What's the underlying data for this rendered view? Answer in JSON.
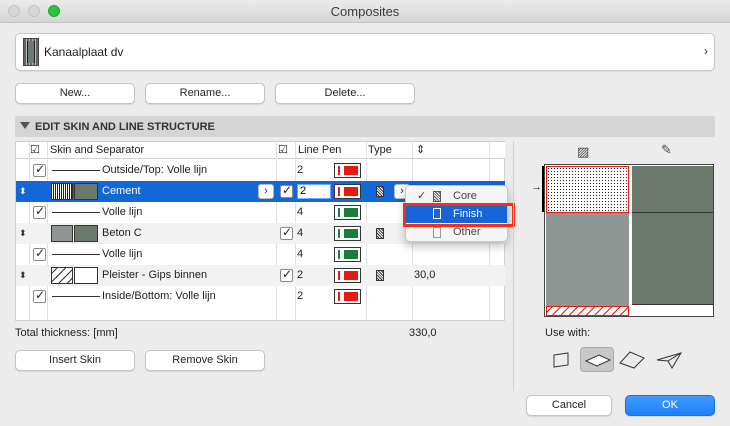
{
  "window": {
    "title": "Composites"
  },
  "composite": {
    "name": "Kanaalplaat dv"
  },
  "buttons": {
    "new": "New...",
    "rename": "Rename...",
    "delete": "Delete...",
    "insert_skin": "Insert Skin",
    "remove_skin": "Remove Skin",
    "cancel": "Cancel",
    "ok": "OK"
  },
  "section": {
    "title": "EDIT SKIN AND LINE STRUCTURE"
  },
  "table": {
    "headers": {
      "skin_sep": "Skin and Separator",
      "line_pen": "Line Pen",
      "type": "Type"
    },
    "rows": [
      {
        "kind": "line",
        "label": "Outside/Top: Volle lijn",
        "pen": "2",
        "pen_color": "#e8190f",
        "checked": true
      },
      {
        "kind": "skin",
        "label": "Cement",
        "pen": "2",
        "pen_color": "#e8190f",
        "checked": true,
        "selected": true,
        "thickness": ""
      },
      {
        "kind": "line",
        "label": "Volle lijn",
        "pen": "4",
        "pen_color": "#1a7d3b",
        "checked": true
      },
      {
        "kind": "skin",
        "label": "Beton C",
        "pen": "4",
        "pen_color": "#1a7d3b",
        "checked": true,
        "thickness": ""
      },
      {
        "kind": "line",
        "label": "Volle lijn",
        "pen": "4",
        "pen_color": "#1a7d3b",
        "checked": true
      },
      {
        "kind": "skin",
        "label": "Pleister - Gips binnen",
        "pen": "2",
        "pen_color": "#e8190f",
        "checked": true,
        "thickness": "30,0"
      },
      {
        "kind": "line",
        "label": "Inside/Bottom: Volle lijn",
        "pen": "2",
        "pen_color": "#e8190f",
        "checked": true
      }
    ]
  },
  "type_menu": {
    "items": [
      "Core",
      "Finish",
      "Other"
    ],
    "checked": "Core",
    "highlighted": "Finish"
  },
  "total": {
    "label": "Total thickness: [mm]",
    "value": "330,0"
  },
  "use_with": {
    "label": "Use with:"
  },
  "colors": {
    "selection": "#1367d6",
    "accent": "#f2301a",
    "skin_gray": "#8f9694",
    "skin_green": "#6b786c"
  }
}
